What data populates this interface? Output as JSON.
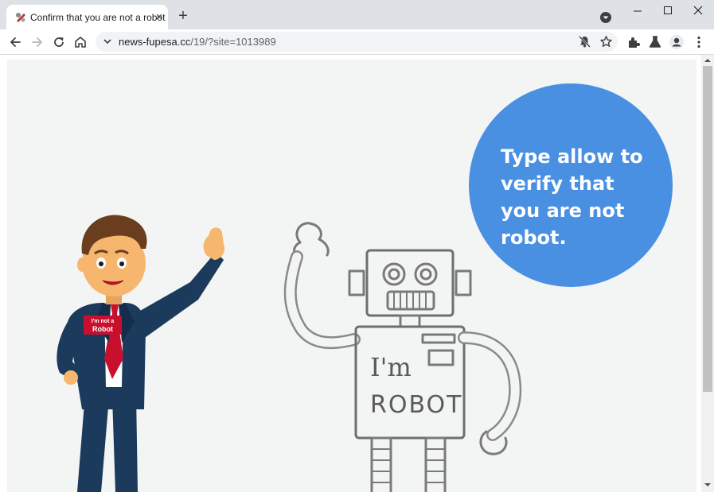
{
  "browser": {
    "tab": {
      "title": "Confirm that you are not a robot",
      "close_glyph": "×"
    },
    "new_tab_glyph": "+",
    "url": {
      "host": "news-fupesa.cc",
      "path": "/19/?site=1013989"
    },
    "icons": [
      "tab-favicon-icon",
      "tab-search-icon",
      "minimize-icon",
      "maximize-icon",
      "close-window-icon",
      "back-icon",
      "forward-icon",
      "reload-icon",
      "home-icon",
      "site-info-icon",
      "notifications-blocked-icon",
      "bookmark-star-icon",
      "extensions-icon",
      "labs-icon",
      "profile-icon",
      "menu-icon"
    ]
  },
  "page": {
    "bubble_text": "Type allow to verify that you are not robot.",
    "badge": {
      "line1": "I'm not a",
      "line2": "Robot"
    },
    "robot_sign": {
      "line1": "I'm",
      "line2": "ROBOT"
    },
    "colors": {
      "bubble": "#4a90e2",
      "background": "#f3f4f4",
      "suit": "#1c3a5c",
      "tie": "#c8102e"
    }
  }
}
